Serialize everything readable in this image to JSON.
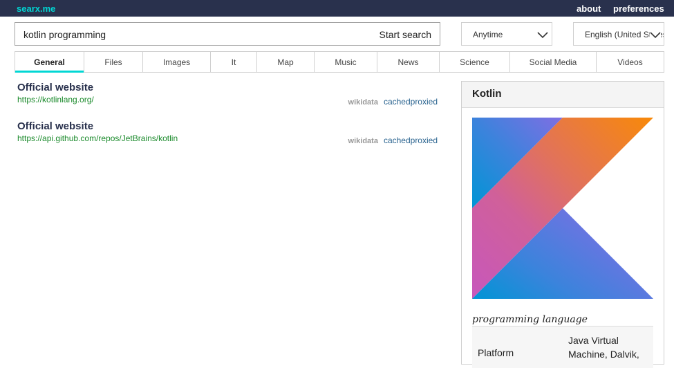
{
  "header": {
    "brand": "searx.me",
    "about": "about",
    "preferences": "preferences"
  },
  "search": {
    "query": "kotlin programming",
    "button": "Start search"
  },
  "filters": {
    "time": "Anytime",
    "language": "English (United States)"
  },
  "tabs": [
    {
      "label": "General",
      "active": true
    },
    {
      "label": "Files"
    },
    {
      "label": "Images"
    },
    {
      "label": "It"
    },
    {
      "label": "Map"
    },
    {
      "label": "Music"
    },
    {
      "label": "News"
    },
    {
      "label": "Science"
    },
    {
      "label": "Social Media"
    },
    {
      "label": "Videos"
    }
  ],
  "results": [
    {
      "title": "Official website",
      "url": "https://kotlinlang.org/",
      "engine": "wikidata",
      "cached": "cached",
      "proxied": "proxied"
    },
    {
      "title": "Official website",
      "url": "https://api.github.com/repos/JetBrains/kotlin",
      "engine": "wikidata",
      "cached": "cached",
      "proxied": "proxied"
    }
  ],
  "infobox": {
    "title": "Kotlin",
    "logo_icon": "kotlin-logo",
    "subtitle": "programming language",
    "attributes": [
      {
        "key": "Platform",
        "value": "Java Virtual Machine, Dalvik,"
      }
    ]
  },
  "colors": {
    "topbar": "#29314d",
    "brand": "#01d7d4",
    "url": "#1a8a2b",
    "link": "#29638f"
  }
}
